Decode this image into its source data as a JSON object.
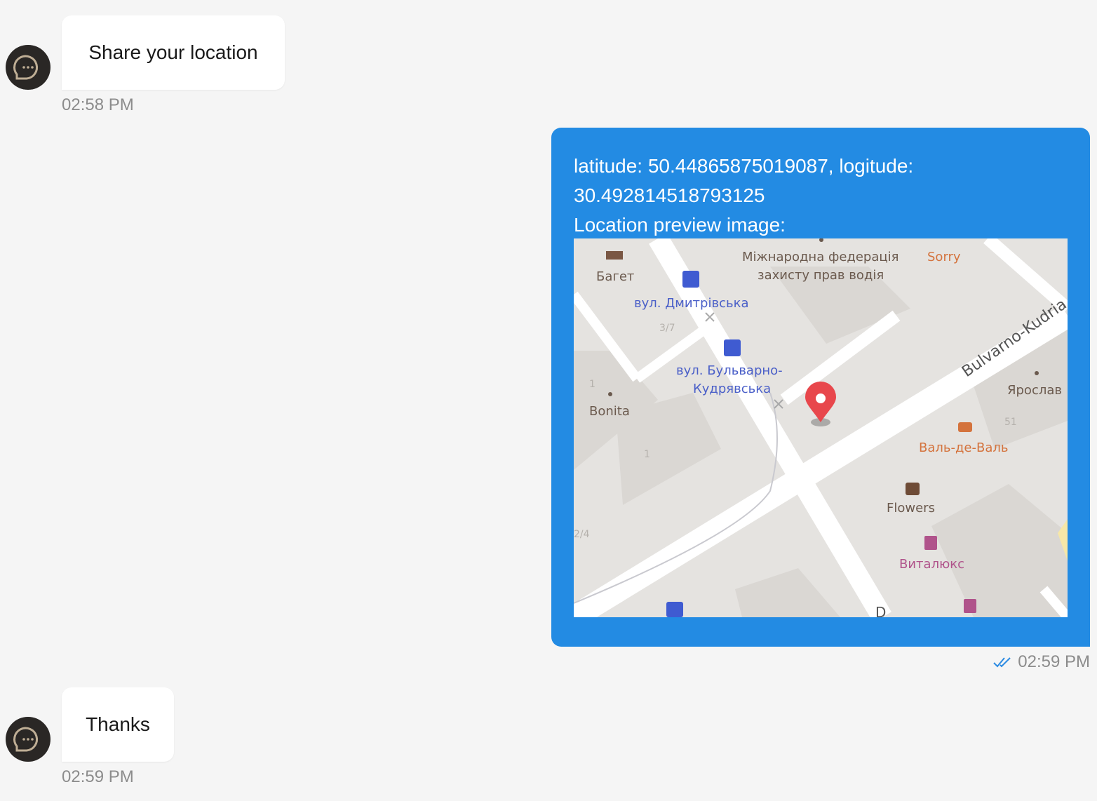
{
  "messages": {
    "incoming_1": {
      "text": "Share your location",
      "time": "02:58 PM"
    },
    "outgoing_1": {
      "line1": "latitude: 50.44865875019087, logitude:",
      "line2": "30.492814518793125",
      "line3": "Location preview image:",
      "time": "02:59 PM",
      "status_icon": "double-check-icon"
    },
    "incoming_2": {
      "text": "Thanks",
      "time": "02:59 PM"
    }
  },
  "map": {
    "labels": {
      "baget": "Багет",
      "federation_1": "Міжнародна федерація",
      "federation_2": "захисту прав водія",
      "sorry": "Sorry",
      "dmytrivska": "вул. Дмитрівська",
      "num_37": "3/7",
      "bulvarno_1": "вул. Бульварно-",
      "bulvarno_2": "Кудрявська",
      "street": "Bulvarno-Kudria",
      "num_1a": "1",
      "bonita": "Bonita",
      "num_1b": "1",
      "yaroslav": "Ярослав",
      "num_51": "51",
      "val": "Валь-де-Валь",
      "flowers": "Flowers",
      "num_24": "2/4",
      "vitalux": "Виталюкс",
      "partial_d": "D"
    }
  },
  "colors": {
    "outgoing_bubble": "#238be3",
    "incoming_bubble": "#ffffff",
    "background": "#f5f5f5",
    "pin": "#e8474c",
    "timestamp": "#8c8c8c",
    "read_check": "#2a8ae2"
  }
}
